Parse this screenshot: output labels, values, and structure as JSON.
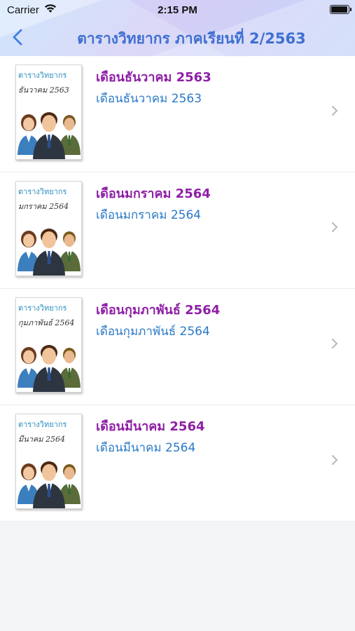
{
  "status_bar": {
    "carrier": "Carrier",
    "time": "2:15 PM",
    "battery_level": 1.0
  },
  "nav": {
    "title": "ตารางวิทยากร ภาคเรียนที่ 2/2563",
    "back_icon": "chevron-left-icon"
  },
  "items": [
    {
      "title": "เดือนธันวาคม 2563",
      "subtitle": "เดือนธันวาคม 2563",
      "thumb_line1": "ตารางวิทยากร",
      "thumb_line2": "ธันวาคม  2563"
    },
    {
      "title": "เดือนมกราคม 2564",
      "subtitle": "เดือนมกราคม 2564",
      "thumb_line1": "ตารางวิทยากร",
      "thumb_line2": "มกราคม  2564"
    },
    {
      "title": "เดือนกุมภาพันธ์ 2564",
      "subtitle": "เดือนกุมภาพันธ์ 2564",
      "thumb_line1": "ตารางวิทยากร",
      "thumb_line2": "กุมภาพันธ์ 2564"
    },
    {
      "title": "เดือนมีนาคม 2564",
      "subtitle": "เดือนมีนาคม 2564",
      "thumb_line1": "ตารางวิทยากร",
      "thumb_line2": "มีนาคม  2564"
    }
  ],
  "colors": {
    "title": "#8e1fa6",
    "subtitle": "#2a7ac7",
    "nav_title": "#3f6fd0"
  }
}
